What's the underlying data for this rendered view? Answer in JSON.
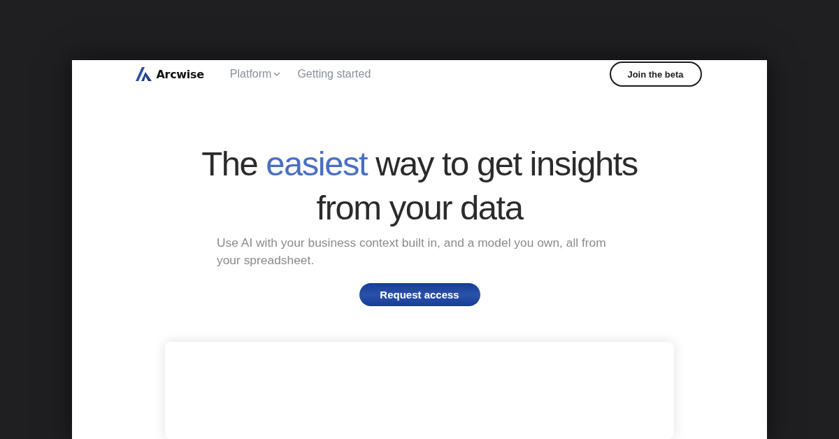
{
  "brand": {
    "name": "Arcwise"
  },
  "nav": [
    {
      "label": "Platform",
      "kind": "dropdown"
    },
    {
      "label": "Getting started",
      "kind": "link"
    }
  ],
  "cta_nav": "Join the beta",
  "hero": {
    "headline": [
      {
        "text": "The ",
        "accent": false
      },
      {
        "text": "easiest",
        "accent": true
      },
      {
        "text": " way to get insights from your data",
        "accent": false
      }
    ],
    "subtitle": "Use AI with your business context built in, and a model you own, all from your spreadsheet.",
    "button": "Request access"
  }
}
